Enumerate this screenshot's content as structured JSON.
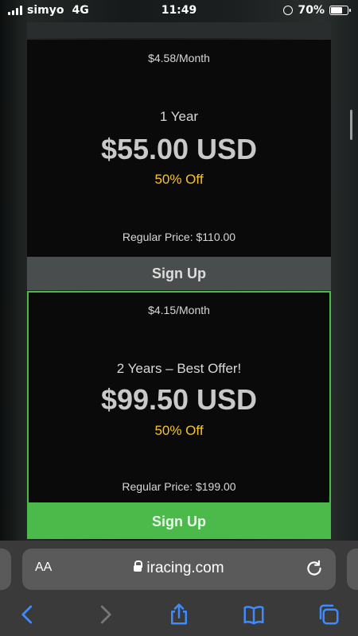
{
  "status_bar": {
    "carrier": "simyo",
    "network": "4G",
    "time": "11:49",
    "battery": "70%",
    "battery_level": 0.7
  },
  "plans": [
    {
      "monthly": "$4.58/Month",
      "title": "1 Year",
      "price": "$55.00 USD",
      "discount": "50% Off",
      "regular": "Regular Price: $110.00",
      "signup_label": "Sign Up"
    },
    {
      "monthly": "$4.15/Month",
      "title": "2 Years – Best Offer!",
      "price": "$99.50 USD",
      "discount": "50% Off",
      "regular": "Regular Price: $199.00",
      "signup_label": "Sign Up"
    }
  ],
  "safari": {
    "text_size_label": "AA",
    "url": "iracing.com",
    "toolbar_icons": [
      "back-icon",
      "forward-icon",
      "share-icon",
      "bookmarks-icon",
      "tabs-icon"
    ]
  },
  "colors": {
    "accent_green": "#4cba4a",
    "discount_yellow": "#f4c430"
  }
}
